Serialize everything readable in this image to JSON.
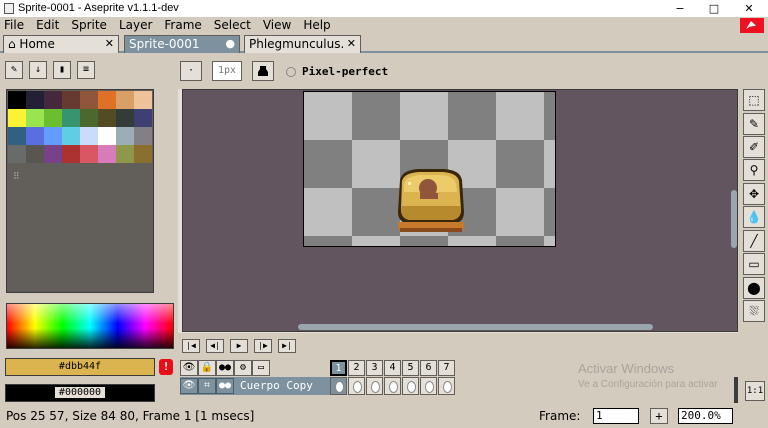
{
  "window": {
    "title": "Sprite-0001 - Aseprite v1.1.1-dev",
    "minimize": "−",
    "maximize": "□",
    "close": "✕"
  },
  "menu": [
    "File",
    "Edit",
    "Sprite",
    "Layer",
    "Frame",
    "Select",
    "View",
    "Help"
  ],
  "tabs": {
    "home": {
      "label": "⌂ Home",
      "close": "✕"
    },
    "sprite": {
      "label": "Sprite-0001",
      "modified": "●"
    },
    "phleg": {
      "label": "Phlegmunculus.",
      "close": "✕"
    }
  },
  "colorbar": {
    "swatches": [
      "#000000",
      "#222034",
      "#45283c",
      "#663931",
      "#8f563b",
      "#df7126",
      "#d9a066",
      "#eec39a",
      "#fbf236",
      "#99e550",
      "#6abe30",
      "#37946e",
      "#4b692f",
      "#524b24",
      "#323c39",
      "#3f3f74",
      "#306082",
      "#5b6ee1",
      "#639bff",
      "#5fcde4",
      "#cbdbfc",
      "#ffffff",
      "#9badb7",
      "#847e87",
      "#696a6a",
      "#595652",
      "#76428a",
      "#ac3232",
      "#d95763",
      "#d77bba",
      "#8f974a",
      "#8a6f30"
    ],
    "palette_tools": [
      "✎",
      "↓",
      "▮",
      "≡"
    ],
    "palette_marker": "⠿",
    "foreground": {
      "hex": "#dbb44f",
      "label": "#dbb44f"
    },
    "background": {
      "hex": "#000000",
      "label": "#000000"
    },
    "warning": "!"
  },
  "contextbar": {
    "brush_type": "·",
    "brush_size": "1px",
    "ink_icon": "ink-icon",
    "pixel_perfect": "Pixel-perfect"
  },
  "toolbar_icons": [
    "marquee-icon",
    "pencil-icon",
    "eyedropper-icon",
    "zoom-icon",
    "move-icon",
    "paint-bucket-icon",
    "line-icon",
    "rectangle-icon",
    "ellipse-icon",
    "blur-icon"
  ],
  "tool_glyphs": [
    "⬚",
    "✎",
    "✐",
    "⚲",
    "✥",
    "💧",
    "╱",
    "▭",
    "⬤",
    "⛆"
  ],
  "playback": [
    "|◀",
    "◀|",
    "▶",
    "|▶",
    "▶|"
  ],
  "timeline": {
    "header_icons": [
      "👁",
      "🔒",
      "●●",
      "⚙",
      "▭"
    ],
    "frames": [
      "1",
      "2",
      "3",
      "4",
      "5",
      "6",
      "7"
    ],
    "active_frame": "1",
    "layer": {
      "eye": "👁",
      "lock": "⌗",
      "link": "●●",
      "name": "Cuerpo Copy"
    },
    "watermark_title": "Activar Windows",
    "watermark_sub": "Ve a Configuración para activar",
    "corner_button": "1:1"
  },
  "status": {
    "text": "Pos 25 57, Size 84 80, Frame 1 [1 msecs]",
    "frame_label": "Frame:",
    "frame_value": "1",
    "plus": "+",
    "zoom": "200.0%"
  }
}
